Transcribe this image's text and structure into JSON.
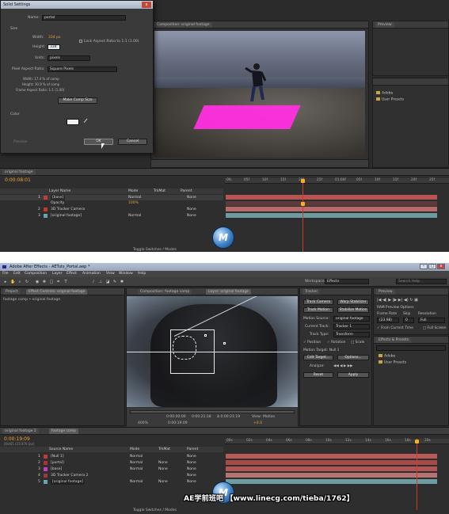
{
  "top": {
    "dialog": {
      "title": "Solid Settings",
      "close": "x",
      "name_label": "Name:",
      "name_value": "portal",
      "size_heading": "Size",
      "width_label": "Width:",
      "width_value": "334 px",
      "lock_label": "Lock Aspect Ratio to 1:1 (1.00)",
      "height_label": "Height:",
      "height_value": "334",
      "units_label": "Units:",
      "units_value": "pixels",
      "par_label": "Pixel Aspect Ratio:",
      "par_value": "Square Pixels",
      "info_width": "Width: 17.4 % of comp",
      "info_height": "Height: 30.9 % of comp",
      "info_far": "Frame Aspect Ratio: 1:1 (1.00)",
      "make_comp_size": "Make Comp Size",
      "color_heading": "Color",
      "preview_label": "Preview",
      "ok": "OK",
      "cancel": "Cancel"
    },
    "comp_tab": "Composition: original footage",
    "preview_tab": "Preview",
    "project_items": [
      "Adobe",
      "User Presets"
    ],
    "timeline": {
      "tab": "original footage",
      "timecode": "0:00:08:01",
      "headers": {
        "source": "Layer Name",
        "mode": "Mode",
        "trkmat": "TrkMat",
        "parent": "Parent"
      },
      "rows": [
        {
          "num": "1",
          "name": "[base]",
          "mode": "Normal",
          "parent": "None",
          "color": "#c23b3b"
        },
        {
          "num": "",
          "name": "Opacity",
          "mode": "100%",
          "parent": "",
          "color": ""
        },
        {
          "num": "2",
          "name": "3D Tracker Camera",
          "mode": "",
          "parent": "None",
          "color": "#c0392b"
        },
        {
          "num": "3",
          "name": "[original footage]",
          "mode": "Normal",
          "parent": "None",
          "color": "#6aa3b0"
        }
      ],
      "ticks": [
        "0fs",
        "05f",
        "10f",
        "15f",
        "20f",
        "25f",
        "01:00f",
        "05f",
        "10f",
        "15f",
        "20f",
        "25f"
      ],
      "toggle_label": "Toggle Switches / Modes"
    }
  },
  "bottom": {
    "window_title": "Adobe After Effects - AETuts_Portal.aep *",
    "menus": [
      "File",
      "Edit",
      "Composition",
      "Layer",
      "Effect",
      "Animation",
      "View",
      "Window",
      "Help"
    ],
    "workspace_label": "Workspace:",
    "workspace_value": "Effects",
    "search_placeholder": "Search Help",
    "project_tab": "Project",
    "effect_controls_tab": "Effect Controls: original footage",
    "breadcrumb": "footage comp • original footage",
    "comp_tab": "Composition: footage comp",
    "layer_tab": "Layer: original footage",
    "tracker": {
      "tab": "Tracker",
      "track_camera": "Track Camera",
      "warp_stabilizer": "Warp Stabilizer",
      "track_motion": "Track Motion",
      "stabilize_motion": "Stabilize Motion",
      "motion_source_label": "Motion Source:",
      "motion_source_value": "original footage",
      "current_track_label": "Current Track:",
      "current_track_value": "Tracker 1",
      "track_type_label": "Track Type:",
      "track_type_value": "Transform",
      "position": "Position",
      "rotation": "Rotation",
      "scale": "Scale",
      "motion_target": "Motion Target: Null 1",
      "edit_target": "Edit Target...",
      "options": "Options...",
      "analyze_label": "Analyze:",
      "reset": "Reset",
      "apply": "Apply"
    },
    "preview": {
      "tab": "Preview",
      "ram_options": "RAM Preview Options",
      "frame_rate": "Frame Rate",
      "skip": "Skip",
      "resolution": "Resolution",
      "fr_value": "(23.98)",
      "skip_value": "0",
      "res_value": "Full",
      "from_current": "From Current Time",
      "full_screen": "Full Screen"
    },
    "effects": {
      "tab": "Effects & Presets",
      "items": [
        "Adobe",
        "User Presets"
      ]
    },
    "viewer_bottom": {
      "timecode_a": "0:00:00:00",
      "timecode_b": "0:00:21:18",
      "delta": "Δ 0:00:21:19",
      "view_label": "View:",
      "view_value": "Motion",
      "zoom": "400%",
      "time": "0:00:19:09",
      "offset": "+0.0"
    },
    "timeline": {
      "tab_a": "original footage 2",
      "tab_b": "footage comp",
      "timecode": "0:00:19:09",
      "fps": "00465 (23.976 fps)",
      "headers": {
        "source": "Source Name",
        "mode": "Mode",
        "trkmat": "TrkMat",
        "parent": "Parent"
      },
      "rows": [
        {
          "num": "1",
          "name": "[Null 1]",
          "mode": "Normal",
          "trkmat": "",
          "parent": "None",
          "color": "#c23b3b"
        },
        {
          "num": "2",
          "name": "[portal]",
          "mode": "Normal",
          "trkmat": "None",
          "parent": "None",
          "color": "#b0303a"
        },
        {
          "num": "3",
          "name": "[base]",
          "mode": "Normal",
          "trkmat": "None",
          "parent": "None",
          "color": "#c43fc0"
        },
        {
          "num": "4",
          "name": "3D Tracker Camera 2",
          "mode": "",
          "trkmat": "",
          "parent": "None",
          "color": "#9b3b3b"
        },
        {
          "num": "5",
          "name": "[original footage]",
          "mode": "Normal",
          "trkmat": "None",
          "parent": "None",
          "color": "#6aa3b0"
        }
      ],
      "ticks": [
        "00s",
        "02s",
        "04s",
        "06s",
        "08s",
        "10s",
        "12s",
        "14s",
        "16s",
        "18s",
        "20s"
      ],
      "toggle_label": "Toggle Switches / Modes"
    },
    "watermark": "AE学前班吧 【www.linecg.com/tieba/1762】",
    "logo_letter": "M"
  }
}
